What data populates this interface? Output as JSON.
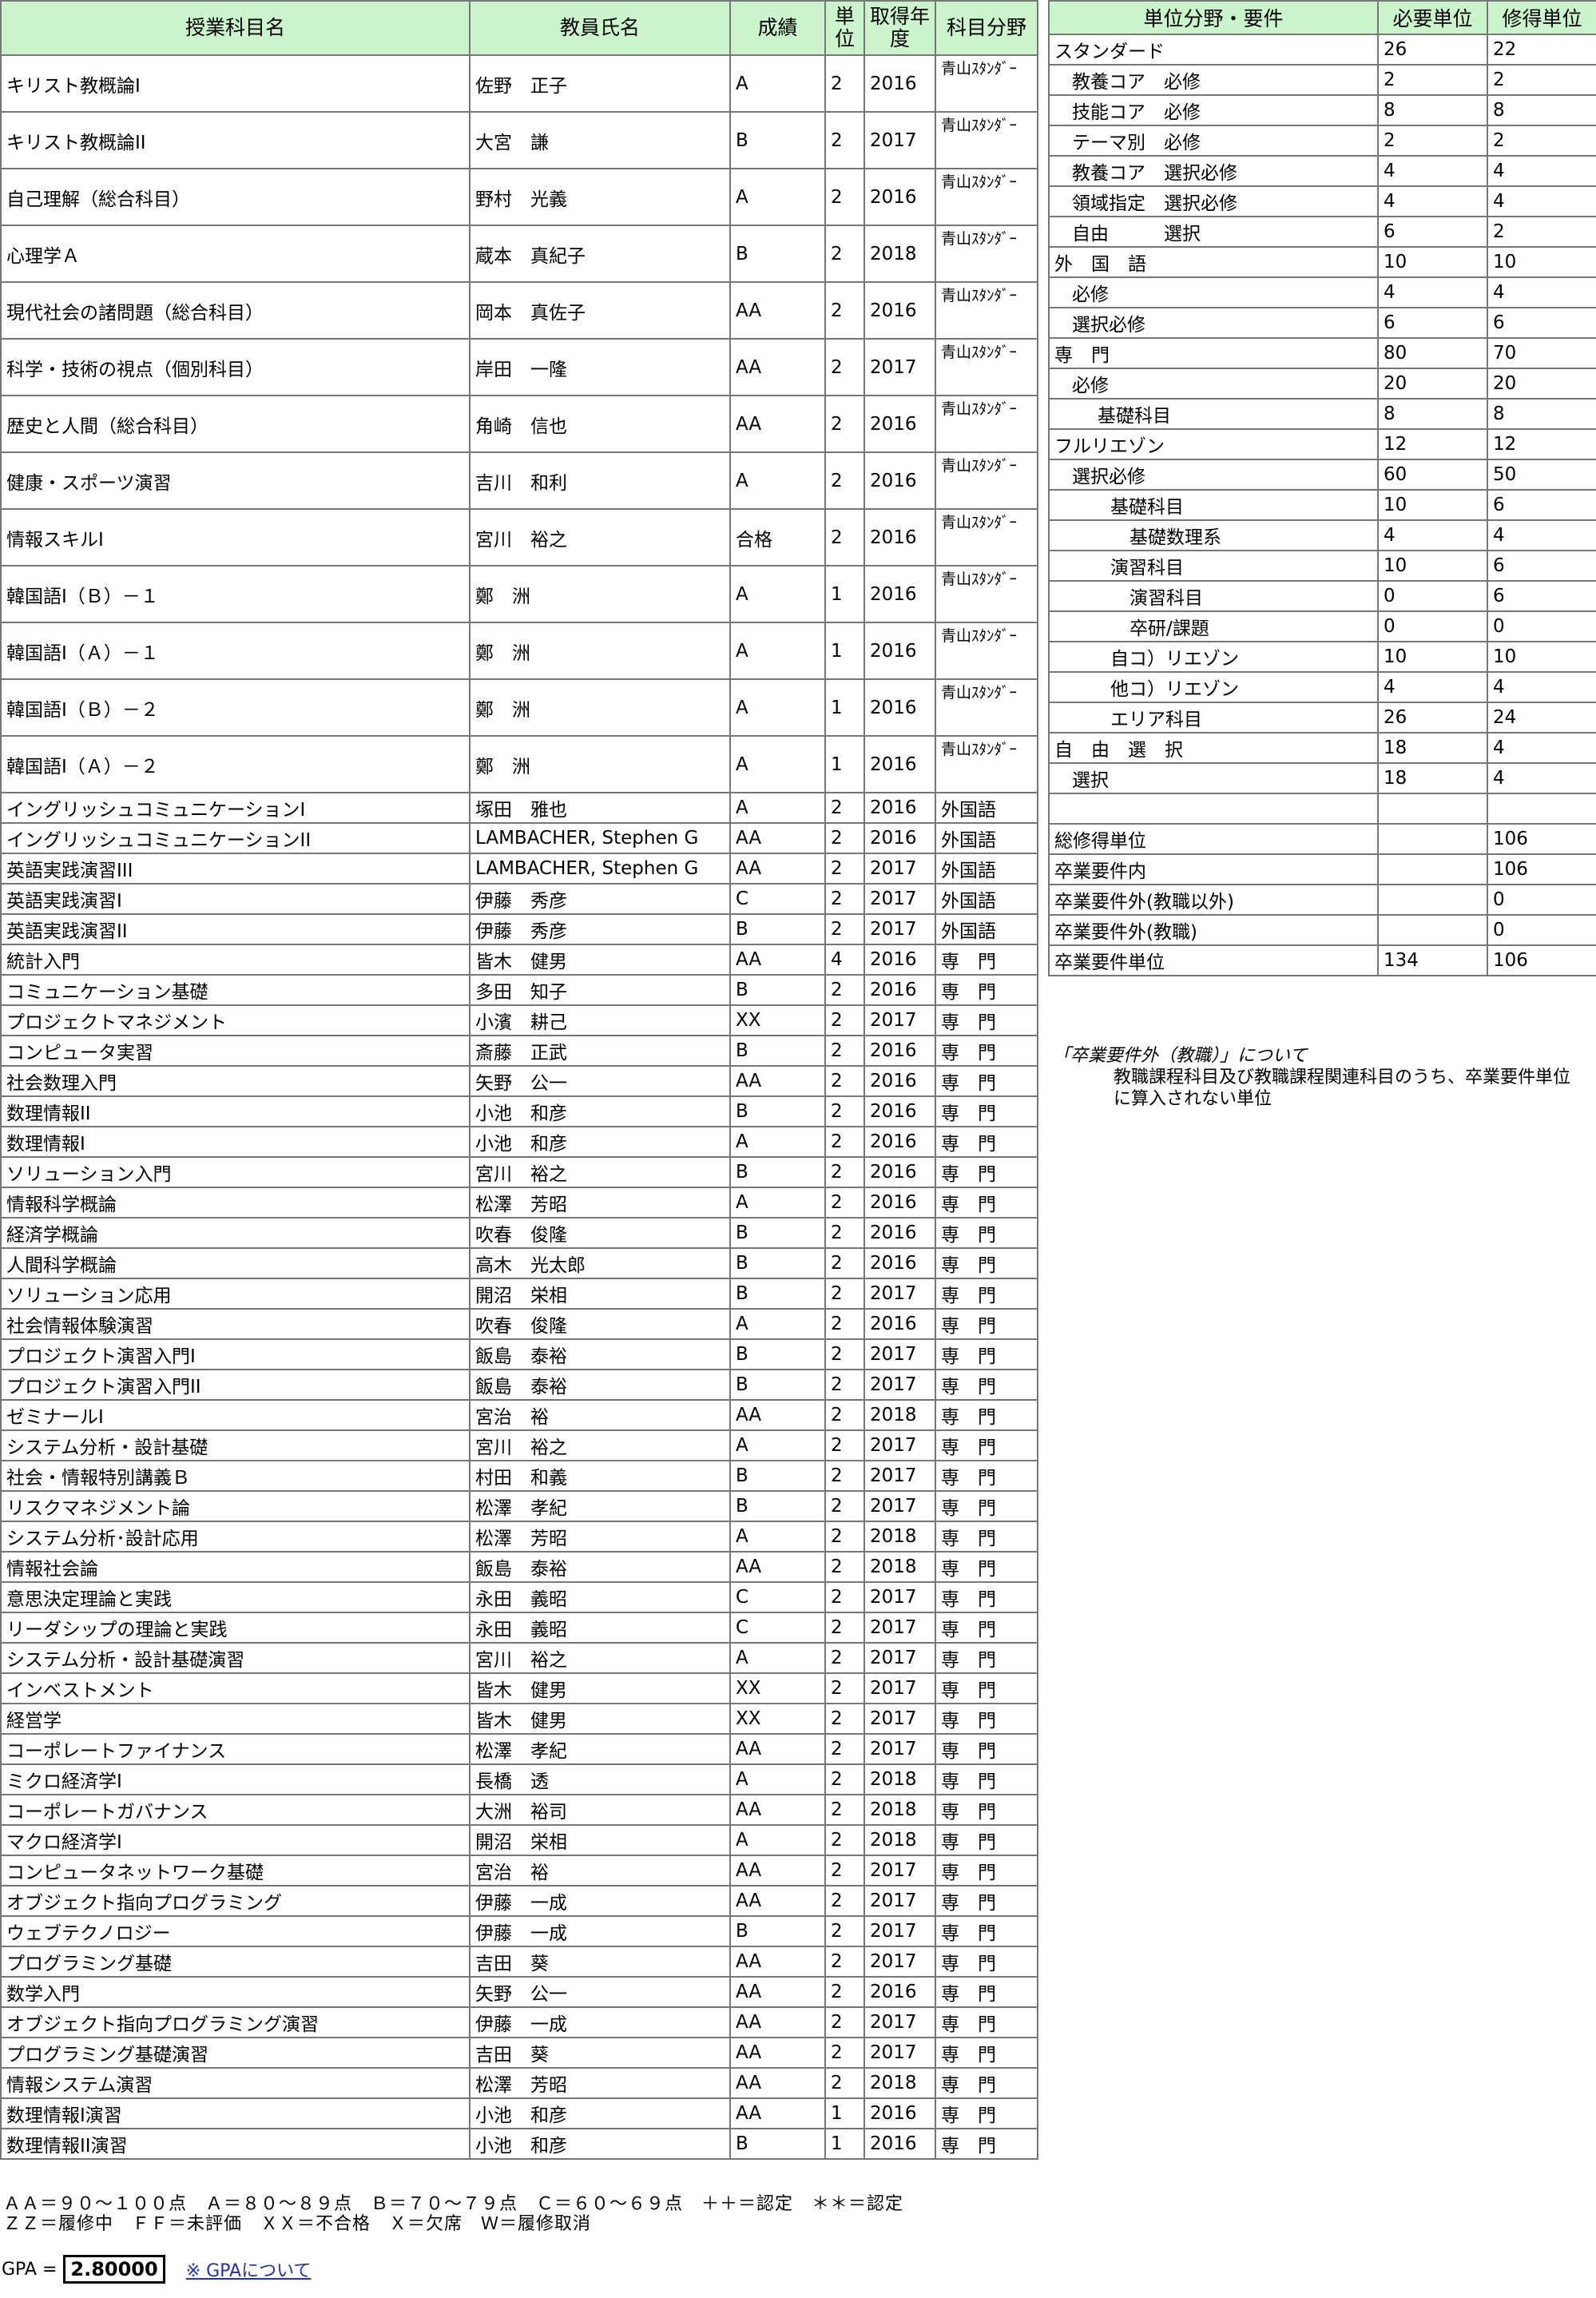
{
  "courses": {
    "headers": [
      "授業科目名",
      "教員氏名",
      "成績",
      "単位",
      "取得年度",
      "科目分野"
    ],
    "rows": [
      [
        "キリスト教概論I",
        "佐野　正子",
        "A",
        "2",
        "2016",
        "青山ｽﾀﾝﾀﾞｰ"
      ],
      [
        "キリスト教概論II",
        "大宮　謙",
        "B",
        "2",
        "2017",
        "青山ｽﾀﾝﾀﾞｰ"
      ],
      [
        "自己理解（総合科目）",
        "野村　光義",
        "A",
        "2",
        "2016",
        "青山ｽﾀﾝﾀﾞｰ"
      ],
      [
        "心理学Ａ",
        "蔵本　真紀子",
        "B",
        "2",
        "2018",
        "青山ｽﾀﾝﾀﾞｰ"
      ],
      [
        "現代社会の諸問題（総合科目）",
        "岡本　真佐子",
        "AA",
        "2",
        "2016",
        "青山ｽﾀﾝﾀﾞｰ"
      ],
      [
        "科学・技術の視点（個別科目）",
        "岸田　一隆",
        "AA",
        "2",
        "2017",
        "青山ｽﾀﾝﾀﾞｰ"
      ],
      [
        "歴史と人間（総合科目）",
        "角崎　信也",
        "AA",
        "2",
        "2016",
        "青山ｽﾀﾝﾀﾞｰ"
      ],
      [
        "健康・スポーツ演習",
        "吉川　和利",
        "A",
        "2",
        "2016",
        "青山ｽﾀﾝﾀﾞｰ"
      ],
      [
        "情報スキルI",
        "宮川　裕之",
        "合格",
        "2",
        "2016",
        "青山ｽﾀﾝﾀﾞｰ"
      ],
      [
        "韓国語I（Ｂ）－１",
        "鄭　洲",
        "A",
        "1",
        "2016",
        "青山ｽﾀﾝﾀﾞｰ"
      ],
      [
        "韓国語I（Ａ）－１",
        "鄭　洲",
        "A",
        "1",
        "2016",
        "青山ｽﾀﾝﾀﾞｰ"
      ],
      [
        "韓国語I（Ｂ）－２",
        "鄭　洲",
        "A",
        "1",
        "2016",
        "青山ｽﾀﾝﾀﾞｰ"
      ],
      [
        "韓国語I（Ａ）－２",
        "鄭　洲",
        "A",
        "1",
        "2016",
        "青山ｽﾀﾝﾀﾞｰ"
      ],
      [
        "イングリッシュコミュニケーションI",
        "塚田　雅也",
        "A",
        "2",
        "2016",
        "外国語"
      ],
      [
        "イングリッシュコミュニケーションII",
        "LAMBACHER, Stephen G",
        "AA",
        "2",
        "2016",
        "外国語"
      ],
      [
        "英語実践演習III",
        "LAMBACHER, Stephen G",
        "AA",
        "2",
        "2017",
        "外国語"
      ],
      [
        "英語実践演習I",
        "伊藤　秀彦",
        "C",
        "2",
        "2017",
        "外国語"
      ],
      [
        "英語実践演習II",
        "伊藤　秀彦",
        "B",
        "2",
        "2017",
        "外国語"
      ],
      [
        "統計入門",
        "皆木　健男",
        "AA",
        "4",
        "2016",
        "専　門"
      ],
      [
        "コミュニケーション基礎",
        "多田　知子",
        "B",
        "2",
        "2016",
        "専　門"
      ],
      [
        "プロジェクトマネジメント",
        "小濱　耕己",
        "XX",
        "2",
        "2017",
        "専　門"
      ],
      [
        "コンピュータ実習",
        "斎藤　正武",
        "B",
        "2",
        "2016",
        "専　門"
      ],
      [
        "社会数理入門",
        "矢野　公一",
        "AA",
        "2",
        "2016",
        "専　門"
      ],
      [
        "数理情報II",
        "小池　和彦",
        "B",
        "2",
        "2016",
        "専　門"
      ],
      [
        "数理情報I",
        "小池　和彦",
        "A",
        "2",
        "2016",
        "専　門"
      ],
      [
        "ソリューション入門",
        "宮川　裕之",
        "B",
        "2",
        "2016",
        "専　門"
      ],
      [
        "情報科学概論",
        "松澤　芳昭",
        "A",
        "2",
        "2016",
        "専　門"
      ],
      [
        "経済学概論",
        "吹春　俊隆",
        "B",
        "2",
        "2016",
        "専　門"
      ],
      [
        "人間科学概論",
        "高木　光太郎",
        "B",
        "2",
        "2016",
        "専　門"
      ],
      [
        "ソリューション応用",
        "開沼　栄相",
        "B",
        "2",
        "2017",
        "専　門"
      ],
      [
        "社会情報体験演習",
        "吹春　俊隆",
        "A",
        "2",
        "2016",
        "専　門"
      ],
      [
        "プロジェクト演習入門I",
        "飯島　泰裕",
        "B",
        "2",
        "2017",
        "専　門"
      ],
      [
        "プロジェクト演習入門II",
        "飯島　泰裕",
        "B",
        "2",
        "2017",
        "専　門"
      ],
      [
        "ゼミナールI",
        "宮治　裕",
        "AA",
        "2",
        "2018",
        "専　門"
      ],
      [
        "システム分析・設計基礎",
        "宮川　裕之",
        "A",
        "2",
        "2017",
        "専　門"
      ],
      [
        "社会・情報特別講義Ｂ",
        "村田　和義",
        "B",
        "2",
        "2017",
        "専　門"
      ],
      [
        "リスクマネジメント論",
        "松澤　孝紀",
        "B",
        "2",
        "2017",
        "専　門"
      ],
      [
        "システム分析･設計応用",
        "松澤　芳昭",
        "A",
        "2",
        "2018",
        "専　門"
      ],
      [
        "情報社会論",
        "飯島　泰裕",
        "AA",
        "2",
        "2018",
        "専　門"
      ],
      [
        "意思決定理論と実践",
        "永田　義昭",
        "C",
        "2",
        "2017",
        "専　門"
      ],
      [
        "リーダシップの理論と実践",
        "永田　義昭",
        "C",
        "2",
        "2017",
        "専　門"
      ],
      [
        "システム分析・設計基礎演習",
        "宮川　裕之",
        "A",
        "2",
        "2017",
        "専　門"
      ],
      [
        "インベストメント",
        "皆木　健男",
        "XX",
        "2",
        "2017",
        "専　門"
      ],
      [
        "経営学",
        "皆木　健男",
        "XX",
        "2",
        "2017",
        "専　門"
      ],
      [
        "コーポレートファイナンス",
        "松澤　孝紀",
        "AA",
        "2",
        "2017",
        "専　門"
      ],
      [
        "ミクロ経済学I",
        "長橋　透",
        "A",
        "2",
        "2018",
        "専　門"
      ],
      [
        "コーポレートガバナンス",
        "大洲　裕司",
        "AA",
        "2",
        "2018",
        "専　門"
      ],
      [
        "マクロ経済学I",
        "開沼　栄相",
        "A",
        "2",
        "2018",
        "専　門"
      ],
      [
        "コンピュータネットワーク基礎",
        "宮治　裕",
        "AA",
        "2",
        "2017",
        "専　門"
      ],
      [
        "オブジェクト指向プログラミング",
        "伊藤　一成",
        "AA",
        "2",
        "2017",
        "専　門"
      ],
      [
        "ウェブテクノロジー",
        "伊藤　一成",
        "B",
        "2",
        "2017",
        "専　門"
      ],
      [
        "プログラミング基礎",
        "吉田　葵",
        "AA",
        "2",
        "2017",
        "専　門"
      ],
      [
        "数学入門",
        "矢野　公一",
        "AA",
        "2",
        "2016",
        "専　門"
      ],
      [
        "オブジェクト指向プログラミング演習",
        "伊藤　一成",
        "AA",
        "2",
        "2017",
        "専　門"
      ],
      [
        "プログラミング基礎演習",
        "吉田　葵",
        "AA",
        "2",
        "2017",
        "専　門"
      ],
      [
        "情報システム演習",
        "松澤　芳昭",
        "AA",
        "2",
        "2018",
        "専　門"
      ],
      [
        "数理情報I演習",
        "小池　和彦",
        "AA",
        "1",
        "2016",
        "専　門"
      ],
      [
        "数理情報II演習",
        "小池　和彦",
        "B",
        "1",
        "2016",
        "専　門"
      ]
    ]
  },
  "requirements": {
    "headers": [
      "単位分野・要件",
      "必要単位",
      "修得単位"
    ],
    "rows": [
      [
        "スタンダード",
        "26",
        "22",
        0
      ],
      [
        "教養コア　必修",
        "2",
        "2",
        1
      ],
      [
        "技能コア　必修",
        "8",
        "8",
        1
      ],
      [
        "テーマ別　必修",
        "2",
        "2",
        1
      ],
      [
        "教養コア　選択必修",
        "4",
        "4",
        1
      ],
      [
        "領域指定　選択必修",
        "4",
        "4",
        1
      ],
      [
        "自由　　　選択",
        "6",
        "2",
        1
      ],
      [
        "外　国　語",
        "10",
        "10",
        0
      ],
      [
        "必修",
        "4",
        "4",
        1
      ],
      [
        "選択必修",
        "6",
        "6",
        1
      ],
      [
        "専　門",
        "80",
        "70",
        0
      ],
      [
        "必修",
        "20",
        "20",
        1
      ],
      [
        "基礎科目",
        "8",
        "8",
        2
      ],
      [
        "フルリエゾン",
        "12",
        "12",
        0
      ],
      [
        "選択必修",
        "60",
        "50",
        1
      ],
      [
        "基礎科目",
        "10",
        "6",
        3
      ],
      [
        "基礎数理系",
        "4",
        "4",
        4
      ],
      [
        "演習科目",
        "10",
        "6",
        3
      ],
      [
        "演習科目",
        "0",
        "6",
        4
      ],
      [
        "卒研/課題",
        "0",
        "0",
        4
      ],
      [
        "自コ）リエゾン",
        "10",
        "10",
        3
      ],
      [
        "他コ）リエゾン",
        "4",
        "4",
        3
      ],
      [
        "エリア科目",
        "26",
        "24",
        3
      ],
      [
        "自　由　選　択",
        "18",
        "4",
        0
      ],
      [
        "選択",
        "18",
        "4",
        1
      ],
      [
        "",
        "",
        "",
        0
      ],
      [
        "総修得単位",
        "",
        "106",
        0
      ],
      [
        "卒業要件内",
        "",
        "106",
        0
      ],
      [
        "卒業要件外(教職以外)",
        "",
        "0",
        0
      ],
      [
        "卒業要件外(教職)",
        "",
        "0",
        0
      ],
      [
        "卒業要件単位",
        "134",
        "106",
        0
      ]
    ]
  },
  "note": {
    "title": "「卒業要件外（教職）」について",
    "body": "教職課程科目及び教職課程関連科目のうち、卒業要件単位に算入されない単位"
  },
  "legend": {
    "line1": "ＡＡ＝９０～１００点　Ａ＝８０～８９点　Ｂ＝７０～７９点　Ｃ＝６０～６９点　＋＋＝認定　＊＊＝認定",
    "line2": "ＺＺ＝履修中　ＦＦ＝未評価　ＸＸ＝不合格　Ｘ＝欠席　Ｗ＝履修取消"
  },
  "gpa": {
    "label": "GPA =",
    "value": "2.80000",
    "link": "※ GPAについて"
  },
  "colors": {
    "header_bg": "#ccf4cc",
    "border": "#777777",
    "link": "#2233aa"
  }
}
